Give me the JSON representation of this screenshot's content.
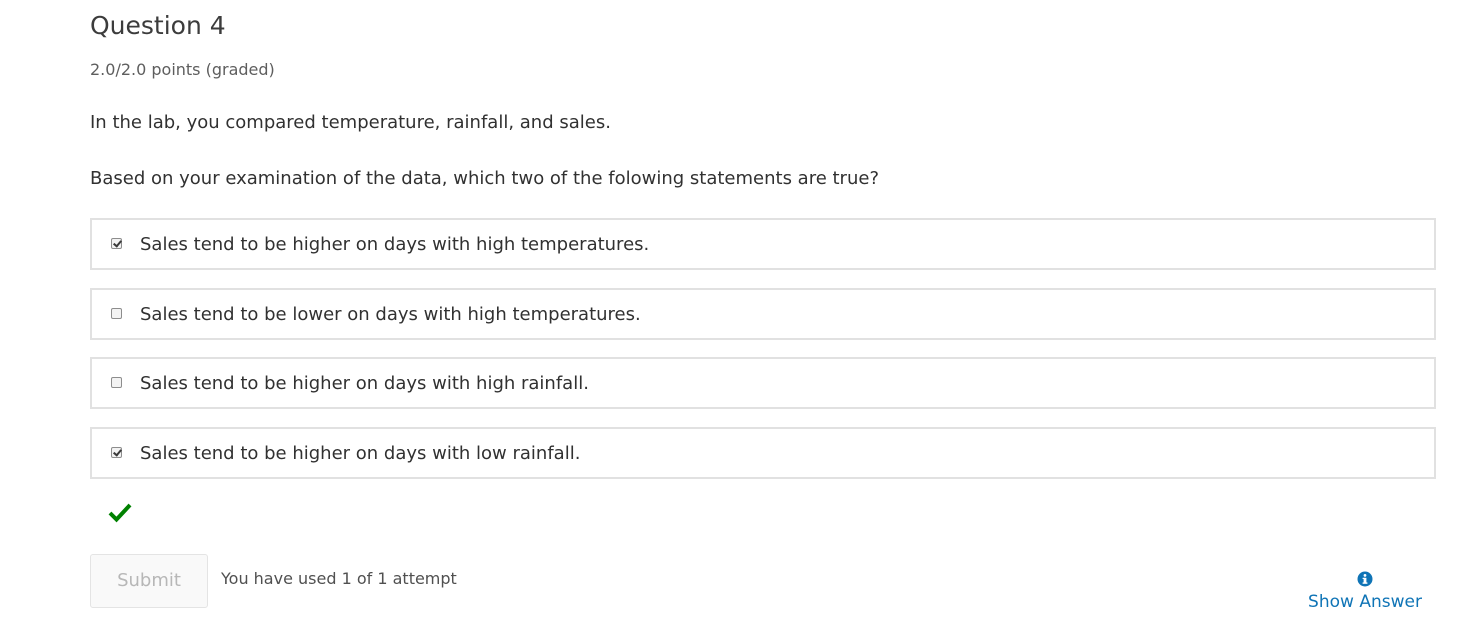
{
  "problem": {
    "title": "Question 4",
    "points": "2.0/2.0 points (graded)",
    "intro": "In the lab, you compared temperature, rainfall, and sales.",
    "question": "Based on your examination of the data, which two of the folowing statements are true?",
    "choices": [
      {
        "label": "Sales tend to be higher on days with high temperatures.",
        "checked": true
      },
      {
        "label": "Sales tend to be lower on days with high temperatures.",
        "checked": false
      },
      {
        "label": "Sales tend to be higher on days with high rainfall.",
        "checked": false
      },
      {
        "label": "Sales tend to be higher on days with low rainfall.",
        "checked": true
      }
    ],
    "result_icon": "checkmark-icon",
    "result_color": "#008100",
    "submit_label": "Submit",
    "attempts_text": "You have used 1 of 1 attempt",
    "show_answer_label": "Show Answer",
    "show_answer_icon": "info-icon",
    "link_color": "#0f74b6"
  }
}
